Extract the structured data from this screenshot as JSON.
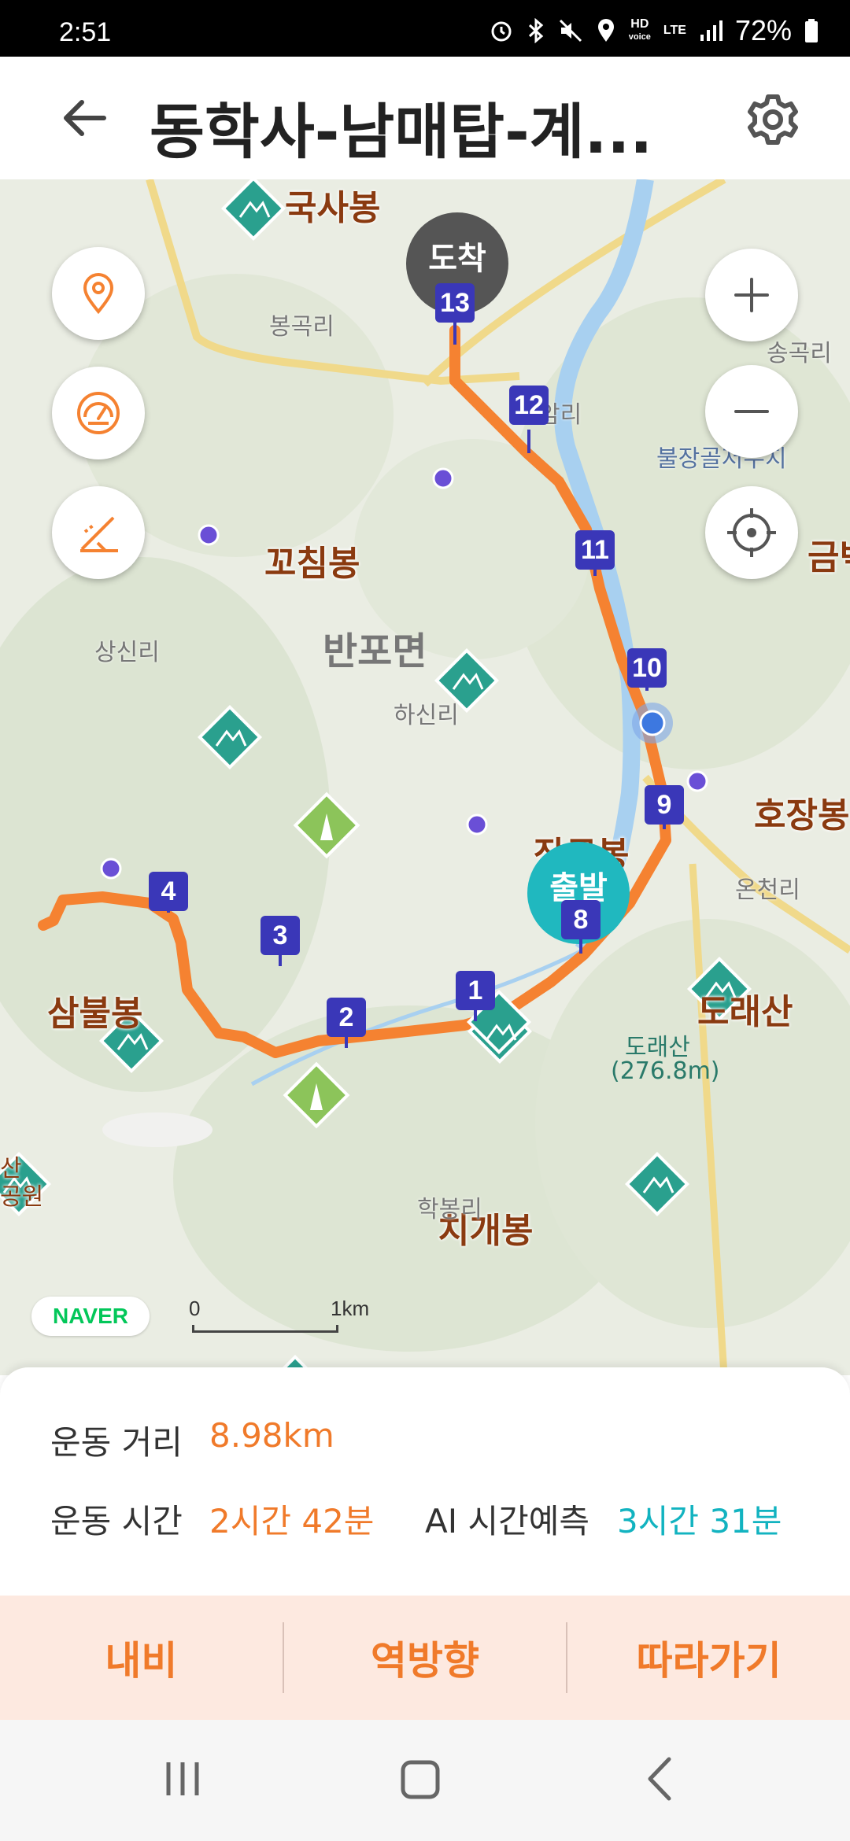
{
  "status_bar": {
    "time": "2:51",
    "hd_label": "HD",
    "voice_label": "voice",
    "lte_label": "LTE",
    "battery": "72%"
  },
  "header": {
    "title": "동학사-남매탑-계...",
    "back_icon": "arrow-left-icon",
    "settings_icon": "gear-icon"
  },
  "map": {
    "region_label": "반포면",
    "villages": [
      "봉곡리",
      "송곡리",
      "암리",
      "상신리",
      "하신리",
      "온천리",
      "학봉리"
    ],
    "pois": [
      "불장골저수지",
      "금벽",
      "산",
      "공원"
    ],
    "peaks": [
      "국사봉",
      "꼬침봉",
      "호장봉",
      "장군봉",
      "삼불봉",
      "도래산",
      "치개봉"
    ],
    "peak_detail": {
      "name": "도래산",
      "elevation": "(276.8m)"
    },
    "start_label": "출발",
    "end_label": "도착",
    "waypoints": [
      "1",
      "2",
      "3",
      "4",
      "8",
      "9",
      "10",
      "11",
      "12",
      "13"
    ],
    "brand": "NAVER",
    "scale_start": "0",
    "scale_end": "1km",
    "route_color": "#f58231",
    "waypoint_color": "#3a37b8"
  },
  "controls": {
    "left": [
      "location-pin-icon",
      "speedometer-icon",
      "elevation-chart-icon"
    ],
    "right": [
      "zoom-in-icon",
      "zoom-out-icon",
      "crosshair-icon"
    ]
  },
  "stats": {
    "distance_label": "운동 거리",
    "distance_value": "8.98km",
    "time_label": "운동 시간",
    "time_value": "2시간 42분",
    "ai_label": "AI 시간예측",
    "ai_value": "3시간 31분"
  },
  "actions": {
    "navi": "내비",
    "reverse": "역방향",
    "follow": "따라가기"
  }
}
